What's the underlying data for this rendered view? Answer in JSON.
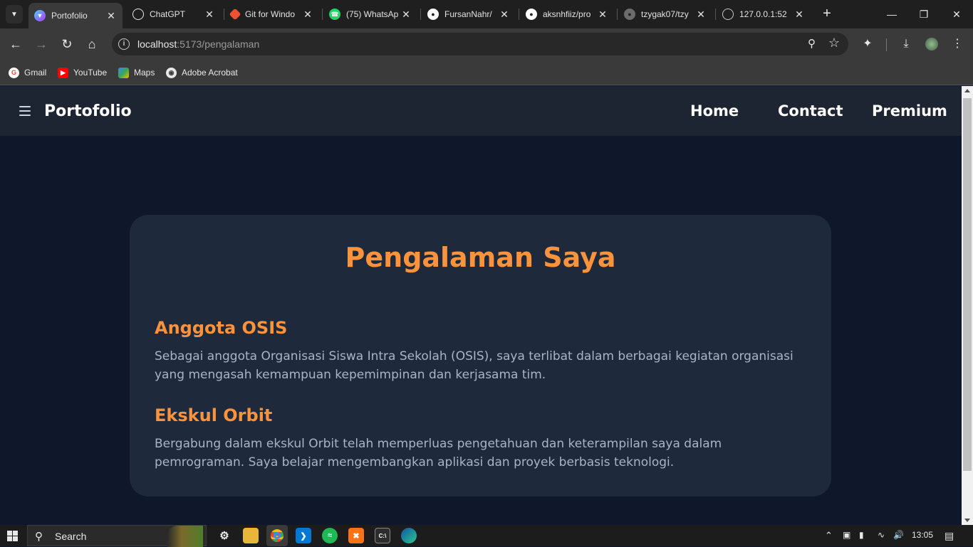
{
  "browser": {
    "tabs": [
      {
        "title": "Portofolio",
        "icon": "vite-icon",
        "color": "#a855f7",
        "active": true
      },
      {
        "title": "ChatGPT",
        "icon": "chatgpt-icon",
        "color": "#ffffff",
        "active": false
      },
      {
        "title": "Git for Windo",
        "icon": "git-icon",
        "color": "#f05133",
        "active": false
      },
      {
        "title": "(75) WhatsAp",
        "icon": "whatsapp-icon",
        "color": "#25d366",
        "active": false
      },
      {
        "title": "FursanNahr/",
        "icon": "github-icon",
        "color": "#ffffff",
        "active": false
      },
      {
        "title": "aksnhfiiz/pro",
        "icon": "github-icon",
        "color": "#ffffff",
        "active": false
      },
      {
        "title": "tzygak07/tzy",
        "icon": "github-icon",
        "color": "#888888",
        "active": false
      },
      {
        "title": "127.0.0.1:52",
        "icon": "globe-icon",
        "color": "#c8c8c8",
        "active": false
      }
    ],
    "url_host": "localhost",
    "url_path": ":5173/pengalaman",
    "bookmarks": [
      {
        "label": "Gmail",
        "icon": "google-icon",
        "color": "#ea4335"
      },
      {
        "label": "YouTube",
        "icon": "youtube-icon",
        "color": "#ff0000"
      },
      {
        "label": "Maps",
        "icon": "maps-icon",
        "color": "#34a853"
      },
      {
        "label": "Adobe Acrobat",
        "icon": "globe-icon",
        "color": "#c8c8c8"
      }
    ]
  },
  "site": {
    "brand": "Portofolio",
    "nav": [
      "Home",
      "Contact",
      "Premium"
    ],
    "heading": "Pengalaman Saya",
    "experiences": [
      {
        "title": "Anggota OSIS",
        "description": "Sebagai anggota Organisasi Siswa Intra Sekolah (OSIS), saya terlibat dalam berbagai kegiatan organisasi yang mengasah kemampuan kepemimpinan dan kerjasama tim."
      },
      {
        "title": "Ekskul Orbit",
        "description": "Bergabung dalam ekskul Orbit telah memperluas pengetahuan dan keterampilan saya dalam pemrograman. Saya belajar mengembangkan aplikasi dan proyek berbasis teknologi."
      }
    ],
    "colors": {
      "accent": "#fb923c",
      "background": "#0f172a",
      "card": "#1e293b",
      "nav": "#1e2532"
    }
  },
  "taskbar": {
    "search_label": "Search",
    "time": "13:05"
  }
}
